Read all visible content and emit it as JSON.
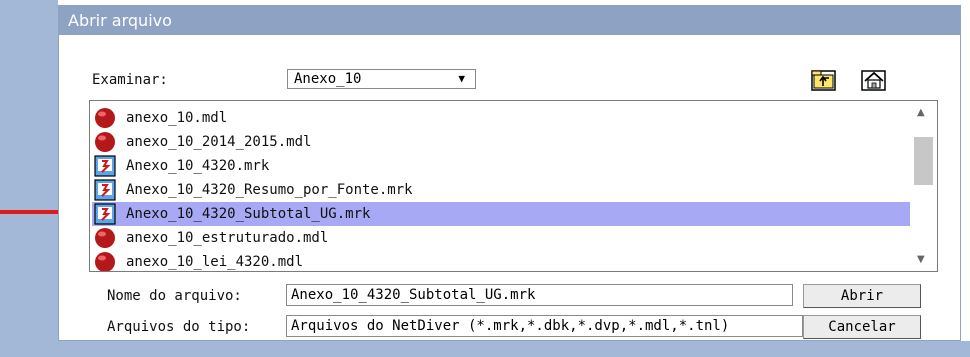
{
  "dialog": {
    "title": "Abrir arquivo"
  },
  "lookin": {
    "label": "Examinar:",
    "value": "Anexo_10",
    "arrow": "▼"
  },
  "toolbar": {
    "up_icon": "folder-up-icon",
    "home_icon": "home-icon"
  },
  "files": [
    {
      "name": "anexo_10.mdl",
      "icon": "mdl-file-icon"
    },
    {
      "name": "anexo_10_2014_2015.mdl",
      "icon": "mdl-file-icon"
    },
    {
      "name": "Anexo_10_4320.mrk",
      "icon": "mrk-file-icon"
    },
    {
      "name": "Anexo_10_4320_Resumo_por_Fonte.mrk",
      "icon": "mrk-file-icon"
    },
    {
      "name": "Anexo_10_4320_Subtotal_UG.mrk",
      "icon": "mrk-file-icon",
      "selected": true
    },
    {
      "name": "anexo_10_estruturado.mdl",
      "icon": "mdl-file-icon"
    },
    {
      "name": "anexo_10_lei_4320.mdl",
      "icon": "mdl-file-icon"
    }
  ],
  "filename": {
    "label": "Nome do arquivo:",
    "value": "Anexo_10_4320_Subtotal_UG.mrk"
  },
  "filetype": {
    "label": "Arquivos do tipo:",
    "value": "Arquivos do NetDiver (*.mrk,*.dbk,*.dvp,*.mdl,*.tnl)"
  },
  "buttons": {
    "open": "Abrir",
    "cancel": "Cancelar"
  },
  "colors": {
    "selection": "#a7a9f4",
    "titlebar": "#8ea3c3",
    "arrow": "#e0191b"
  }
}
